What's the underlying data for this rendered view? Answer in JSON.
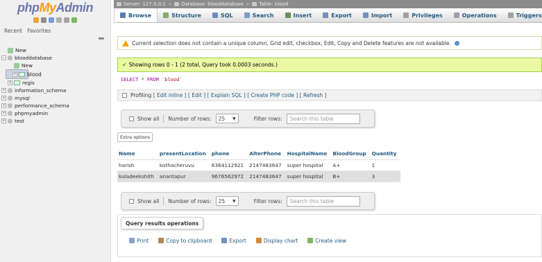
{
  "sidebar": {
    "logo": {
      "php": "php",
      "my": "My",
      "admin": "Admin"
    },
    "recent_tab": "Recent",
    "favorites_tab": "Favorites",
    "tree": [
      {
        "label": "New",
        "level": 1,
        "kind": "new"
      },
      {
        "label": "blooddatabase",
        "level": 0,
        "kind": "db",
        "expander": "−"
      },
      {
        "label": "New",
        "level": 1,
        "kind": "new"
      },
      {
        "label": "blood",
        "level": 1,
        "kind": "table",
        "expander": "+"
      },
      {
        "label": "regis",
        "level": 1,
        "kind": "table",
        "expander": "+"
      },
      {
        "label": "information_schema",
        "level": 0,
        "kind": "db",
        "expander": "+"
      },
      {
        "label": "mysql",
        "level": 0,
        "kind": "db",
        "expander": "+"
      },
      {
        "label": "performance_schema",
        "level": 0,
        "kind": "db",
        "expander": "+"
      },
      {
        "label": "phpmyadmin",
        "level": 0,
        "kind": "db",
        "expander": "+"
      },
      {
        "label": "test",
        "level": 0,
        "kind": "db",
        "expander": "+"
      }
    ]
  },
  "breadcrumb": {
    "server": "Server: 127.0.0.1",
    "database": "Database: blooddatabase",
    "table": "Table: blood",
    "separator": "»"
  },
  "tabs": [
    {
      "label": "Browse",
      "icon": "browse-icon",
      "color": "#5a7fb0"
    },
    {
      "label": "Structure",
      "icon": "structure-icon",
      "color": "#8aa86a"
    },
    {
      "label": "SQL",
      "icon": "sql-icon",
      "color": "#6f8fc0"
    },
    {
      "label": "Search",
      "icon": "search-icon",
      "color": "#7c9cc6"
    },
    {
      "label": "Insert",
      "icon": "insert-icon",
      "color": "#6c8f5e"
    },
    {
      "label": "Export",
      "icon": "export-icon",
      "color": "#7390ba"
    },
    {
      "label": "Import",
      "icon": "import-icon",
      "color": "#7390ba"
    },
    {
      "label": "Privileges",
      "icon": "privileges-icon",
      "color": "#a0a0a0"
    },
    {
      "label": "Operations",
      "icon": "operations-icon",
      "color": "#9aa0ac"
    },
    {
      "label": "Triggers",
      "icon": "triggers-icon",
      "color": "#a0a0a0"
    }
  ],
  "notice": {
    "text": "Current selection does not contain a unique column. Grid edit, checkbox, Edit, Copy and Delete features are not available."
  },
  "success": {
    "text": "Showing rows 0 - 1 (2 total, Query took 0.0003 seconds.)"
  },
  "sql": {
    "kw_select": "SELECT",
    "star": "*",
    "kw_from": "FROM",
    "table": "`blood`"
  },
  "profiling": {
    "label": "Profiling",
    "links": "[ Edit inline ] [ Edit ] [ Explain SQL ] [ Create PHP code ] [ Refresh ]"
  },
  "nav": {
    "show_all": "Show all",
    "rows_label": "Number of rows:",
    "rows_value": "25",
    "filter_label": "Filter rows:",
    "filter_placeholder": "Search this table"
  },
  "extra_options": "Extra options",
  "results": {
    "columns": [
      "Name",
      "presentLocation",
      "phone",
      "AlterPhone",
      "HospitalName",
      "BloodGroup",
      "Quantity"
    ],
    "rows": [
      [
        "harish",
        "kothacheruvu",
        "6364112921",
        "2147483647",
        "super hospital",
        "A+",
        "1"
      ],
      [
        "kuladeekshith",
        "anantapur",
        "9676562972",
        "2147483647",
        "super hospital",
        "B+",
        "3"
      ]
    ]
  },
  "query_ops": {
    "title": "Query results operations",
    "print": "Print",
    "copy": "Copy to clipboard",
    "export": "Export",
    "chart": "Display chart",
    "view": "Create view"
  }
}
